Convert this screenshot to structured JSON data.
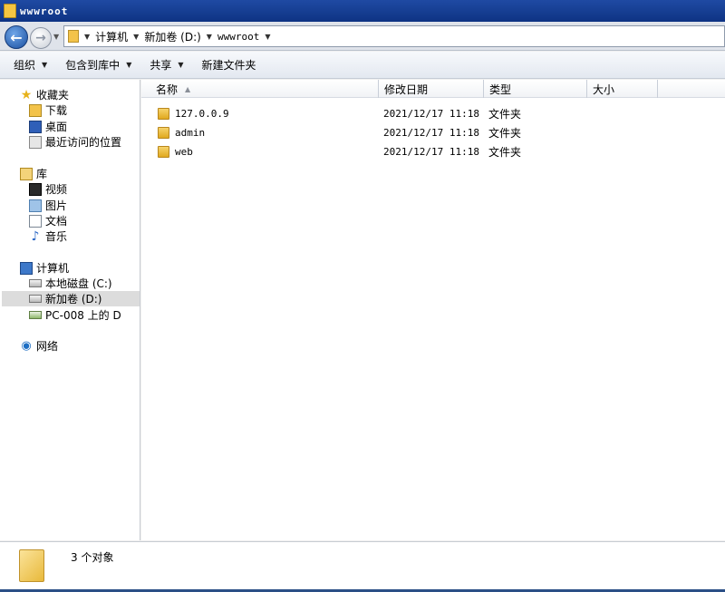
{
  "window": {
    "title": "wwwroot"
  },
  "address": {
    "crumbs": [
      "计算机",
      "新加卷 (D:)",
      "wwwroot"
    ]
  },
  "toolbar": {
    "organize": "组织",
    "include_library": "包含到库中",
    "share": "共享",
    "new_folder": "新建文件夹"
  },
  "nav": {
    "favorites": "收藏夹",
    "downloads": "下载",
    "desktop": "桌面",
    "recent": "最近访问的位置",
    "libraries": "库",
    "videos": "视频",
    "pictures": "图片",
    "documents": "文档",
    "music": "音乐",
    "computer": "计算机",
    "local_disk": "本地磁盘 (C:)",
    "new_volume": "新加卷 (D:)",
    "network_drive": "PC-008 上的 D",
    "network": "网络"
  },
  "columns": {
    "name": "名称",
    "modified": "修改日期",
    "type": "类型",
    "size": "大小"
  },
  "files": [
    {
      "name": "127.0.0.9",
      "modified": "2021/12/17 11:18",
      "type": "文件夹",
      "size": ""
    },
    {
      "name": "admin",
      "modified": "2021/12/17 11:18",
      "type": "文件夹",
      "size": ""
    },
    {
      "name": "web",
      "modified": "2021/12/17 11:18",
      "type": "文件夹",
      "size": ""
    }
  ],
  "status": {
    "count": "3 个对象"
  }
}
